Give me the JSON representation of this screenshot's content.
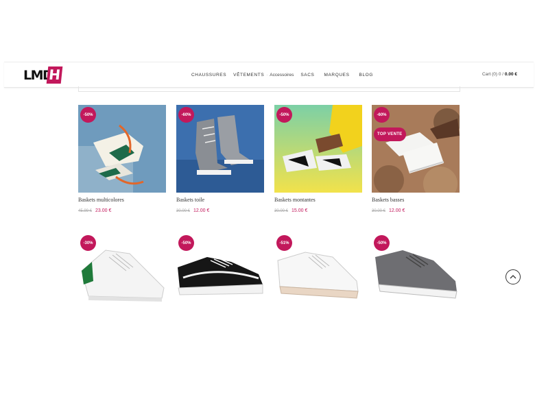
{
  "logo": {
    "text_left": "LMD",
    "text_box": "H"
  },
  "nav": {
    "items": [
      "CHAUSSURES",
      "VÊTEMENTS",
      "Accessoires",
      "SACS",
      "MARQUES",
      "BLOG"
    ],
    "separator": "·"
  },
  "cart": {
    "label": "Cart (0) 0 /",
    "total": "0.00 €"
  },
  "products": [
    {
      "name": "Baskets multicolores",
      "badge": "-50%",
      "old_price": "45.99 €",
      "price": "23.00 €"
    },
    {
      "name": "Baskets toile",
      "badge": "-60%",
      "old_price": "30.00 €",
      "price": "12.00 €"
    },
    {
      "name": "Baskets montantes",
      "badge": "-50%",
      "old_price": "30.00 €",
      "price": "15.00 €"
    },
    {
      "name": "Baskets basses",
      "badge": "-60%",
      "tag": "TOP VENTE",
      "old_price": "30.00 €",
      "price": "12.00 €"
    },
    {
      "badge": "-30%"
    },
    {
      "badge": "-50%"
    },
    {
      "badge": "-51%"
    },
    {
      "badge": "-50%"
    }
  ],
  "colors": {
    "accent": "#c2185b",
    "text": "#333333",
    "old_price": "#aaaaaa"
  },
  "icons": {
    "scroll_top": "chevron-up-icon"
  }
}
